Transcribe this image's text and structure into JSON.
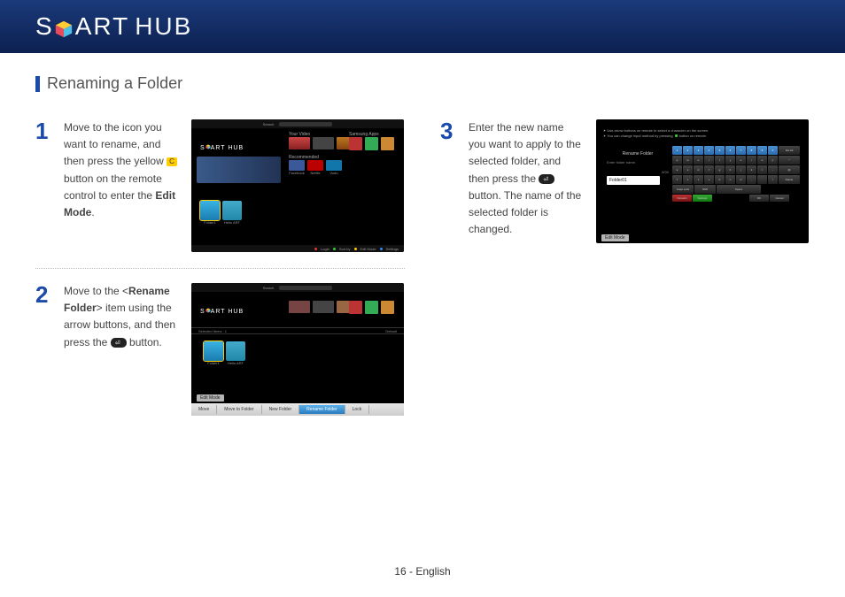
{
  "header": {
    "logo_part1": "S",
    "logo_part2": "ART",
    "logo_hub": "HUB"
  },
  "section_title": "Renaming a Folder",
  "steps": {
    "s1": {
      "num": "1",
      "text_a": "Move to the icon you want to rename, and then press the yellow ",
      "text_b": " button on the remote control to enter the ",
      "bold": "Edit Mode",
      "text_c": "."
    },
    "s2": {
      "num": "2",
      "text_a": "Move to the <",
      "bold": "Rename Folder",
      "text_b": "> item using the arrow buttons, and then press the ",
      "text_c": " button."
    },
    "s3": {
      "num": "3",
      "text_a": "Enter the new name you want to apply to the selected folder, and then press the ",
      "text_b": " button. The name of the selected folder is changed."
    }
  },
  "tv": {
    "logo": "S ART HUB",
    "search": "Search",
    "your_video": "Your Video",
    "samsung_apps": "Samsung Apps",
    "recommended": "Recommended",
    "apps": {
      "facebook": "Facebook",
      "netflix": "Netflix",
      "vudu": "Vudu"
    },
    "folder1": "Folder1",
    "hello_art": "Hello ART",
    "bottom": {
      "login": "Login",
      "sortby": "Sort by",
      "editmode": "Edit Mode",
      "settings": "Settings"
    },
    "edit": {
      "selected": "Selected Items : 1",
      "default": "Default",
      "mode_label": "Edit Mode",
      "move": "Move",
      "move_to_folder": "Move to Folder",
      "new_folder": "New Folder",
      "rename_folder": "Rename Folder",
      "lock": "Lock"
    },
    "rename": {
      "hint1": "Use arrow buttons on remote to select a character on the screen.",
      "hint2": "You can change input method by pressing",
      "hint3": "button on remote.",
      "title": "Rename Folder",
      "sub": "Enter folder name.",
      "value": "Folder01",
      "counter": "8/30",
      "numbers": [
        "1",
        "2",
        "3",
        "4",
        "5",
        "6",
        "7",
        "8",
        "9",
        "0",
        "Del All"
      ],
      "row1": [
        "q",
        "w",
        "e",
        "r",
        "t",
        "y",
        "u",
        "i",
        "o",
        "p",
        "^"
      ],
      "row2": [
        "a",
        "s",
        "d",
        "f",
        "g",
        "h",
        "j",
        "k",
        "l",
        "-",
        "@"
      ],
      "row3": [
        "z",
        "x",
        "c",
        "v",
        "b",
        "n",
        "m",
        ",",
        ".",
        "/",
        "Delete"
      ],
      "row4": [
        "Caps Lock",
        "Shift",
        "Space"
      ],
      "bottom_row": [
        "Numeric",
        "Settings",
        "OK",
        "Cancel"
      ]
    }
  },
  "footer": "16 - English",
  "icons": {
    "c_button": "C"
  }
}
